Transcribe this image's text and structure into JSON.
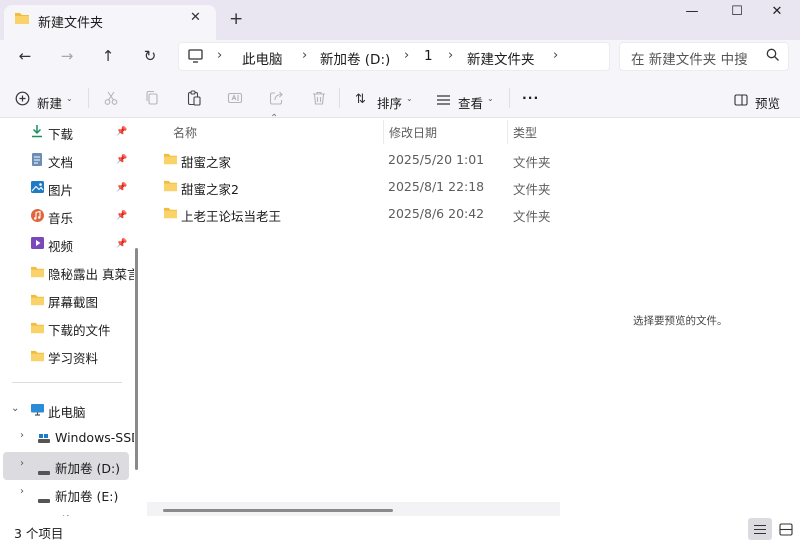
{
  "window": {
    "tab_title": "新建文件夹",
    "new_tab": "+",
    "controls": {
      "minimize": "—",
      "maximize": "☐",
      "close": "✕"
    }
  },
  "navigation": {
    "breadcrumb": [
      "此电脑",
      "新加卷 (D:)",
      "1",
      "新建文件夹"
    ],
    "separator": "›",
    "search_placeholder": "在 新建文件夹 中搜"
  },
  "toolbar": {
    "new_label": "新建",
    "sort_label": "排序",
    "view_label": "查看",
    "more_label": "···",
    "preview_label": "预览"
  },
  "sidebar": {
    "quick_access": [
      {
        "label": "下载",
        "icon": "download-icon",
        "pinned": true
      },
      {
        "label": "文档",
        "icon": "document-icon",
        "pinned": true
      },
      {
        "label": "图片",
        "icon": "picture-icon",
        "pinned": true
      },
      {
        "label": "音乐",
        "icon": "music-icon",
        "pinned": true
      },
      {
        "label": "视频",
        "icon": "video-icon",
        "pinned": true
      },
      {
        "label": "隐秘露出 真菜言",
        "icon": "folder-icon",
        "pinned": false
      },
      {
        "label": "屏幕截图",
        "icon": "folder-icon",
        "pinned": false
      },
      {
        "label": "下载的文件",
        "icon": "folder-icon",
        "pinned": false
      },
      {
        "label": "学习资料",
        "icon": "folder-icon",
        "pinned": false
      }
    ],
    "this_pc": "此电脑",
    "drives": [
      {
        "label": "Windows-SSD",
        "selected": false
      },
      {
        "label": "新加卷 (D:)",
        "selected": true
      },
      {
        "label": "新加卷 (E:)",
        "selected": false
      }
    ],
    "partial_item": "网络"
  },
  "file_list": {
    "columns": [
      "名称",
      "修改日期",
      "类型"
    ],
    "rows": [
      {
        "name": "甜蜜之家",
        "date": "2025/5/20 1:01",
        "type": "文件夹"
      },
      {
        "name": "甜蜜之家2",
        "date": "2025/8/1 22:18",
        "type": "文件夹"
      },
      {
        "name": "上老王论坛当老王",
        "date": "2025/8/6 20:42",
        "type": "文件夹"
      }
    ]
  },
  "preview": {
    "message": "选择要预览的文件。"
  },
  "status": {
    "item_count": "3 个项目"
  },
  "colors": {
    "titlebar": "#e9e6f2",
    "chrome": "#f6f5fa",
    "folder": "#f2bd3c",
    "selected": "#dcdce0",
    "accent": "#0067c0"
  }
}
